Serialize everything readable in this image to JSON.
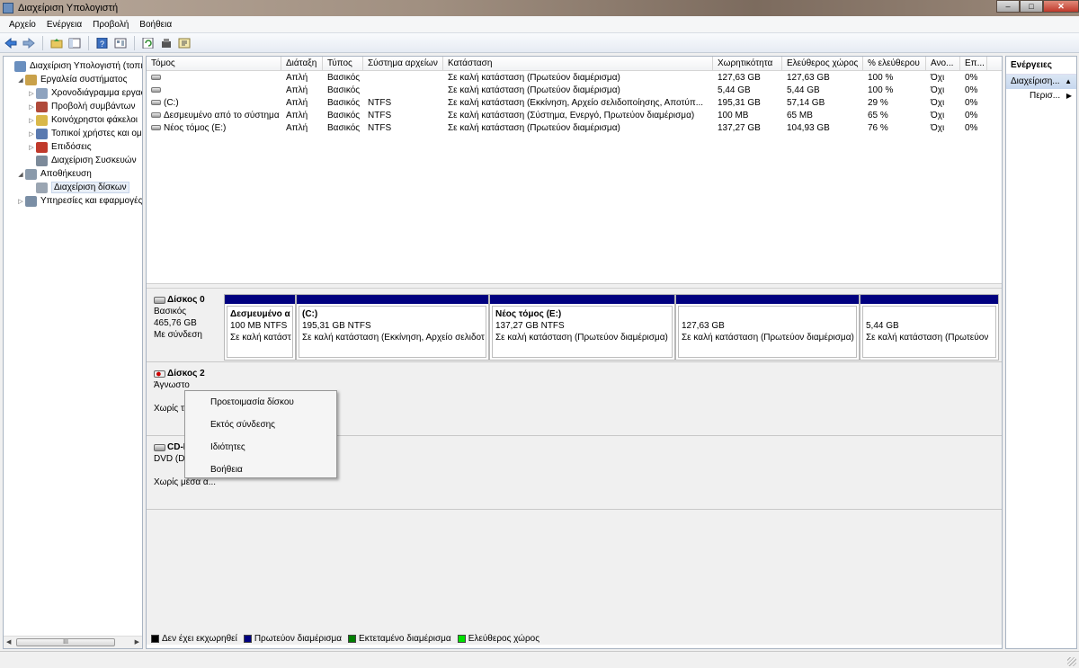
{
  "window": {
    "title": "Διαχείριση Υπολογιστή",
    "controls": [
      "–",
      "□",
      "✕"
    ]
  },
  "menubar": {
    "items": [
      "Αρχείο",
      "Ενέργεια",
      "Προβολή",
      "Βοήθεια"
    ]
  },
  "toolbar": {
    "icons": [
      "back-icon",
      "forward-icon",
      "up-folder-icon",
      "show-hide-tree-icon",
      "help-icon",
      "properties-icon",
      "refresh-icon",
      "settings-icon",
      "export-icon"
    ]
  },
  "tree": {
    "items": [
      {
        "label": "Διαχείριση Υπολογιστή (τοπικ",
        "level": 0,
        "arrow": "",
        "icon_color": "#6a8fbf"
      },
      {
        "label": "Εργαλεία συστήματος",
        "level": 1,
        "arrow": "◢",
        "icon_color": "#c9a14a"
      },
      {
        "label": "Χρονοδιάγραμμα εργασ",
        "level": 2,
        "arrow": "▷",
        "icon_color": "#8ea3bf"
      },
      {
        "label": "Προβολή συμβάντων",
        "level": 2,
        "arrow": "▷",
        "icon_color": "#b04a3a"
      },
      {
        "label": "Κοινόχρηστοι φάκελοι",
        "level": 2,
        "arrow": "▷",
        "icon_color": "#d9b84a"
      },
      {
        "label": "Τοπικοί χρήστες και ομ",
        "level": 2,
        "arrow": "▷",
        "icon_color": "#5a7ab0"
      },
      {
        "label": "Επιδόσεις",
        "level": 2,
        "arrow": "▷",
        "icon_color": "#c0392b"
      },
      {
        "label": "Διαχείριση Συσκευών",
        "level": 2,
        "arrow": "",
        "icon_color": "#7c8a9a"
      },
      {
        "label": "Αποθήκευση",
        "level": 1,
        "arrow": "◢",
        "icon_color": "#8a9aab"
      },
      {
        "label": "Διαχείριση δίσκων",
        "level": 2,
        "arrow": "",
        "icon_color": "#9aa5b2",
        "selected": true
      },
      {
        "label": "Υπηρεσίες και εφαρμογές",
        "level": 1,
        "arrow": "▷",
        "icon_color": "#7a8ea5"
      }
    ],
    "scroll_thumb": "III"
  },
  "volumes": {
    "columns": [
      "Τόμος",
      "Διάταξη",
      "Τύπος",
      "Σύστημα αρχείων",
      "Κατάσταση",
      "Χωρητικότητα",
      "Ελεύθερος χώρος",
      "% ελεύθερου",
      "Ανο...",
      "Επ..."
    ],
    "rows": [
      [
        "",
        "Απλή",
        "Βασικός",
        "",
        "Σε καλή κατάσταση (Πρωτεύον διαμέρισμα)",
        "127,63 GB",
        "127,63 GB",
        "100 %",
        "Όχι",
        "0%"
      ],
      [
        "",
        "Απλή",
        "Βασικός",
        "",
        "Σε καλή κατάσταση (Πρωτεύον διαμέρισμα)",
        "5,44 GB",
        "5,44 GB",
        "100 %",
        "Όχι",
        "0%"
      ],
      [
        "(C:)",
        "Απλή",
        "Βασικός",
        "NTFS",
        "Σε καλή κατάσταση (Εκκίνηση, Αρχείο σελιδοποίησης, Αποτύπ...",
        "195,31 GB",
        "57,14 GB",
        "29 %",
        "Όχι",
        "0%"
      ],
      [
        "Δεσμευμένο από το σύστημα",
        "Απλή",
        "Βασικός",
        "NTFS",
        "Σε καλή κατάσταση (Σύστημα, Ενεργό, Πρωτεύον διαμέρισμα)",
        "100 MB",
        "65 MB",
        "65 %",
        "Όχι",
        "0%"
      ],
      [
        "Νέος τόμος (E:)",
        "Απλή",
        "Βασικός",
        "NTFS",
        "Σε καλή κατάσταση (Πρωτεύον διαμέρισμα)",
        "137,27 GB",
        "104,93 GB",
        "76 %",
        "Όχι",
        "0%"
      ]
    ]
  },
  "disks": [
    {
      "name": "Δίσκος 0",
      "lines": [
        "Βασικός",
        "465,76 GB",
        "Με σύνδεση"
      ],
      "icon": "disk-icon",
      "partitions": [
        {
          "name": "Δεσμευμένο α",
          "size": "100 MB NTFS",
          "status": "Σε καλή κατάστ"
        },
        {
          "name": "(C:)",
          "size": "195,31 GB NTFS",
          "status": "Σε καλή κατάσταση (Εκκίνηση, Αρχείο σελιδοτ"
        },
        {
          "name": "Νέος τόμος  (E:)",
          "size": "137,27 GB NTFS",
          "status": "Σε καλή κατάσταση (Πρωτεύον διαμέρισμα)"
        },
        {
          "name": "",
          "size": "127,63 GB",
          "status": "Σε καλή κατάσταση (Πρωτεύον διαμέρισμα)"
        },
        {
          "name": "",
          "size": "5,44 GB",
          "status": "Σε καλή κατάσταση (Πρωτεύον"
        }
      ]
    },
    {
      "name": "Δίσκος 2",
      "lines": [
        "Άγνωστο",
        "",
        "Χωρίς τ"
      ],
      "icon": "disk-warning-icon"
    },
    {
      "name": "CD-I",
      "lines": [
        "DVD (D:",
        "",
        "Χωρίς μέσα α..."
      ],
      "icon": "cd-drive-icon"
    }
  ],
  "legend": [
    {
      "label": "Δεν έχει εκχωρηθεί",
      "color": "#000000"
    },
    {
      "label": "Πρωτεύον διαμέρισμα",
      "color": "#00007f"
    },
    {
      "label": "Εκτεταμένο διαμέρισμα",
      "color": "#007f00"
    },
    {
      "label": "Ελεύθερος χώρος",
      "color": "#00e000"
    }
  ],
  "context_menu": {
    "items": [
      "Προετοιμασία δίσκου",
      "Εκτός σύνδεσης",
      "Ιδιότητες",
      "Βοήθεια"
    ]
  },
  "actions": {
    "title": "Ενέργειες",
    "section": "Διαχείριση...",
    "more": "Περισ..."
  }
}
